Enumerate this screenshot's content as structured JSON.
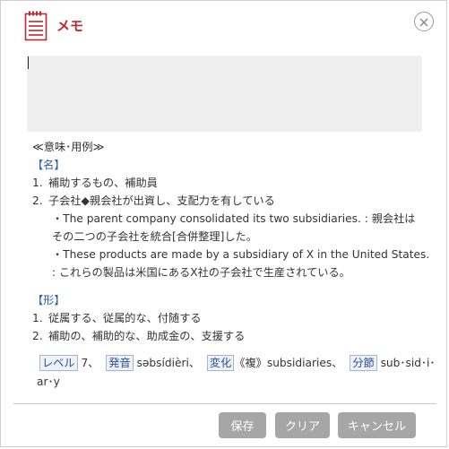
{
  "header": {
    "title": "メモ",
    "icon": "memo-icon",
    "close_icon": "close-icon"
  },
  "memo": {
    "value": ""
  },
  "entry": {
    "section_title": "≪意味･用例≫",
    "noun": {
      "label": "【名】",
      "items": [
        {
          "num": "1.",
          "text": "補助するもの、補助員"
        },
        {
          "num": "2.",
          "text": "子会社◆親会社が出資し、支配力を有している"
        }
      ],
      "examples": [
        "・The parent company consolidated its two subsidiaries. : 親会社は",
        "その二つの子会社を統合[合併整理]した。",
        "・These products are made by a subsidiary of X in the United States.",
        ": これらの製品は米国にあるX社の子会社で生産されている。"
      ]
    },
    "adjective": {
      "label": "【形】",
      "items": [
        {
          "num": "1.",
          "text": "従属する、従属的な、付随する"
        },
        {
          "num": "2.",
          "text": "補助の、補助的な、助成金の、支援する"
        }
      ]
    },
    "meta": {
      "level_label": "レベル",
      "level_value": "7、",
      "pron_label": "発音",
      "pron_value": "səbsídièri、",
      "change_label": "変化",
      "change_value": "《複》subsidiaries、",
      "syll_label": "分節",
      "syll_value": "sub･sid･i･",
      "syll_value2": "ar･y"
    }
  },
  "buttons": {
    "save": "保存",
    "clear": "クリア",
    "cancel": "キャンセル"
  },
  "colors": {
    "title": "#c0262d",
    "link": "#2a5ba8",
    "button": "#a6a6a6"
  }
}
